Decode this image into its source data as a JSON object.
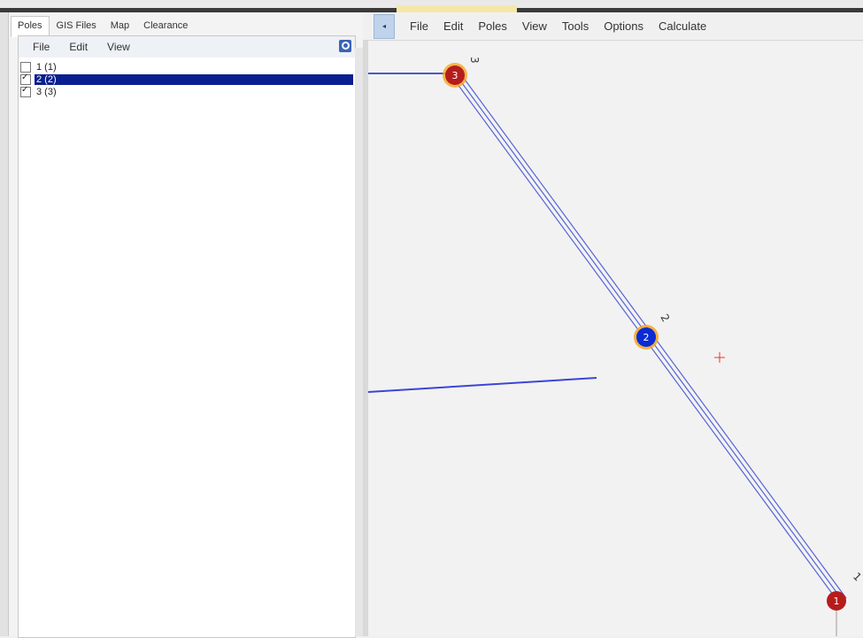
{
  "tabs": [
    "Poles",
    "GIS Files",
    "Map",
    "Clearance"
  ],
  "panel_menu": [
    "File",
    "Edit",
    "View"
  ],
  "poles_list": [
    {
      "label": "1  (1)",
      "checked": false,
      "selected": false
    },
    {
      "label": "2  (2)",
      "checked": true,
      "selected": true
    },
    {
      "label": "3  (3)",
      "checked": true,
      "selected": false
    }
  ],
  "main_menu": [
    "File",
    "Edit",
    "Poles",
    "View",
    "Tools",
    "Options",
    "Calculate"
  ],
  "collapse_glyph": "◂",
  "map": {
    "poles": [
      {
        "id": "3",
        "side_label": "3",
        "fill": "#b71c1c",
        "ring": "#f0a020"
      },
      {
        "id": "2",
        "side_label": "2",
        "fill": "#0a2bd6",
        "ring": "#f0a020"
      },
      {
        "id": "1",
        "side_label": "1",
        "fill": "#b71c1c",
        "ring": "none"
      }
    ],
    "line_color": "#5563d6",
    "cursor_color": "#e53935"
  },
  "colors": {
    "selection": "#0a1f8f",
    "accent": "#3a63b8"
  }
}
